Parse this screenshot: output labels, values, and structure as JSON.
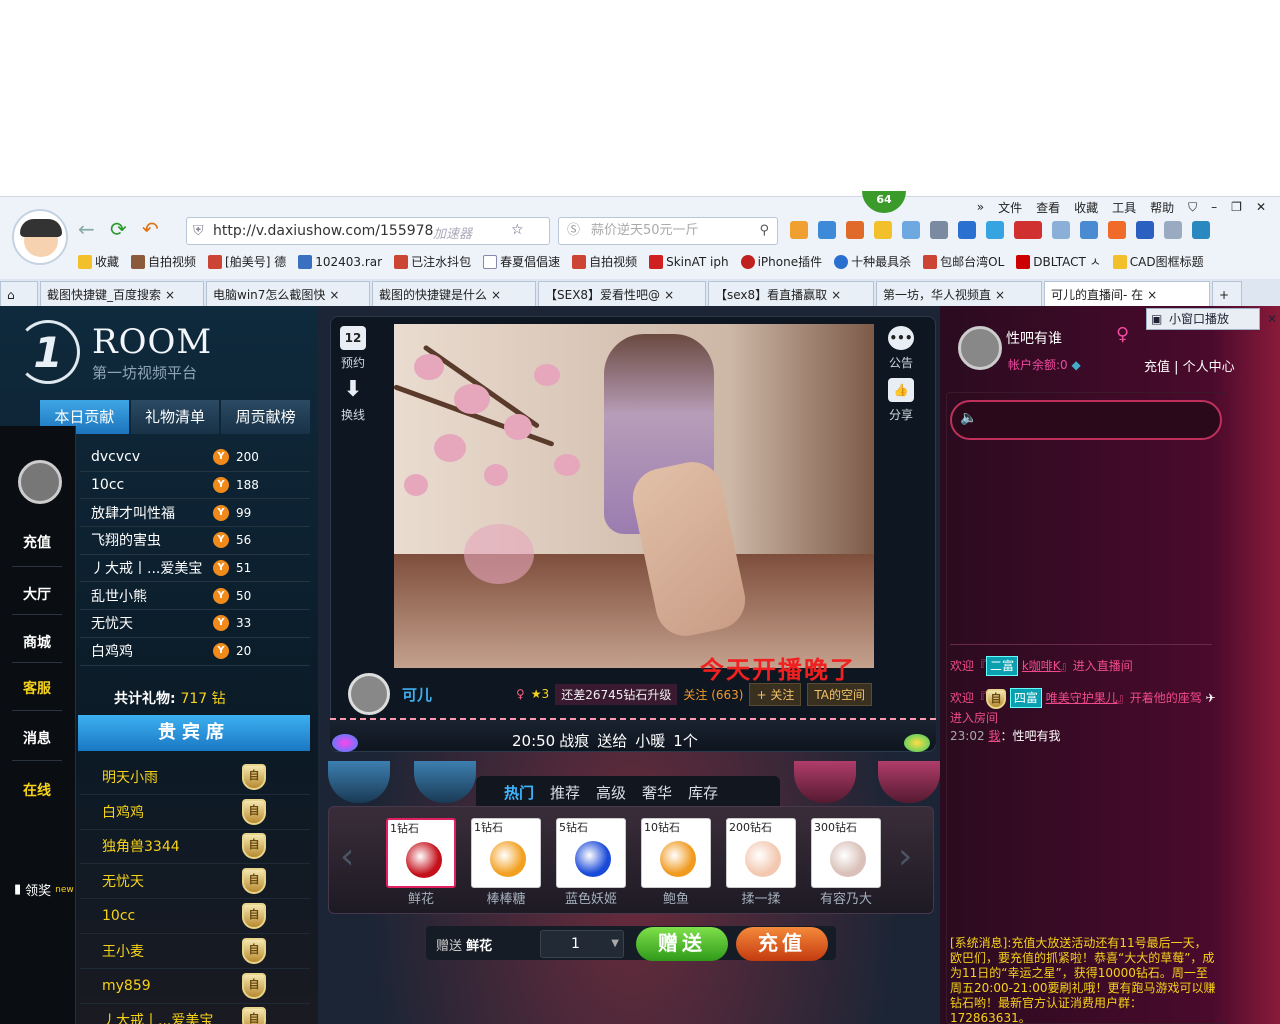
{
  "browser": {
    "menu": [
      "»",
      "文件",
      "查看",
      "收藏",
      "工具",
      "帮助"
    ],
    "badge": "64",
    "url": "http://v.daxiushow.com/155978",
    "accelerator": "加速器",
    "search_placeholder": "蒜价逆天50元一斤",
    "bookmarks": [
      "收藏",
      "自拍视频",
      "[舶美号] 德",
      "102403.rar",
      "已注水抖包",
      "春夏倡倡速",
      "自拍视频",
      "SkinAT iph",
      "iPhone插件",
      "十种最具杀",
      "包邮台湾OL",
      "DBLTACT ㅅ",
      "CAD图框标题"
    ],
    "tabs": [
      {
        "title": "截图快捷键_百度搜索"
      },
      {
        "title": "电脑win7怎么截图快"
      },
      {
        "title": "截图的快捷键是什么"
      },
      {
        "title": "【SEX8】爱看性吧@"
      },
      {
        "title": "【sex8】看直播赢取"
      },
      {
        "title": "第一坊，华人视频直"
      },
      {
        "title": "可儿的直播间- 在"
      }
    ]
  },
  "site": {
    "logo_mark": "1",
    "logo_title": "ROOM",
    "logo_sub": "第一坊视频平台"
  },
  "left": {
    "tabs": [
      "本日贡献",
      "礼物清单",
      "周贡献榜"
    ],
    "sidebar": [
      "充值",
      "大厅",
      "商城",
      "客服",
      "消息",
      "在线"
    ],
    "reward": "领奖",
    "reward_tag": "new",
    "leaderboard": [
      {
        "name": "dvcvcv",
        "value": "200"
      },
      {
        "name": "10cc",
        "value": "188"
      },
      {
        "name": "放肆才叫性福",
        "value": "99"
      },
      {
        "name": "飞翔的害虫",
        "value": "56"
      },
      {
        "name": "丿大戒丨...爱美宝",
        "value": "51"
      },
      {
        "name": "乱世小熊",
        "value": "50"
      },
      {
        "name": "无忧天",
        "value": "33"
      },
      {
        "name": "白鸡鸡",
        "value": "20"
      }
    ],
    "coin_glyph": "Y",
    "gifts_label": "共计礼物:",
    "gifts_count": "717 钻",
    "vip_title": "贵宾席",
    "vip": [
      "明天小雨",
      "白鸡鸡",
      "独角兽3344",
      "无忧天",
      "10cc",
      "王小麦",
      "my859",
      "丿大戒丨...爱美宝"
    ],
    "vip_badge": "自"
  },
  "center": {
    "controls": {
      "reserve": "预约",
      "reserve_day": "12",
      "switch": "换线",
      "notice": "公告",
      "share": "分享"
    },
    "video_caption": "今天开播晚了",
    "host_name": "可儿",
    "upgrade": "还差26745钻石升级",
    "follow_count": "关注 (663)",
    "follow_btn": "+ 关注",
    "space_btn": "TA的空间",
    "ticker": {
      "time": "20:50",
      "from": "战痕",
      "verb": "送给",
      "to": "小暖",
      "qty": "1个"
    },
    "gift_tabs": [
      "热门",
      "推荐",
      "高级",
      "奢华",
      "库存"
    ],
    "gifts": [
      {
        "price": "1钻石",
        "name": "鲜花",
        "color": "#c4101a"
      },
      {
        "price": "1钻石",
        "name": "棒棒糖",
        "color": "#f2a020"
      },
      {
        "price": "5钻石",
        "name": "蓝色妖姬",
        "color": "#1a4ad8"
      },
      {
        "price": "10钻石",
        "name": "鲍鱼",
        "color": "#f09a20"
      },
      {
        "price": "200钻石",
        "name": "揉一揉",
        "color": "#f3c8b0"
      },
      {
        "price": "300钻石",
        "name": "有容乃大",
        "color": "#d9c0b8"
      }
    ],
    "send_label": "赠送",
    "send_gift": "鲜花",
    "quantity": "1",
    "send_btn": "赠送",
    "recharge_btn": "充值"
  },
  "right": {
    "mini_window": "小窗口播放",
    "user": "性吧有谁",
    "balance": "帐户余额:0",
    "links": "充值 | 个人中心",
    "chat": {
      "welcome1_pre": "欢迎『",
      "welcome1_level": "二富",
      "welcome1_user": "k咖啡K",
      "welcome1_post": "』进入直播间",
      "welcome2_pre": "欢迎『",
      "welcome2_level": "四富",
      "welcome2_user": "唯美守护果儿",
      "welcome2_post": "』开着他的座驾",
      "welcome2_end": "进入房间",
      "msg_time": "23:02",
      "msg_who": "我",
      "msg_text": "：性吧有我"
    },
    "system": "[系统消息]:充值大放送活动还有11号最后一天，欧巴们，要充值的抓紧啦！恭喜“大大的草莓”，成为11日的“幸运之星”，获得10000钻石。周一至周五20:00-21:00要刷礼哦！更有跑马游戏可以赚钻石哟！最新官方认证消费用户群：172863631。"
  }
}
